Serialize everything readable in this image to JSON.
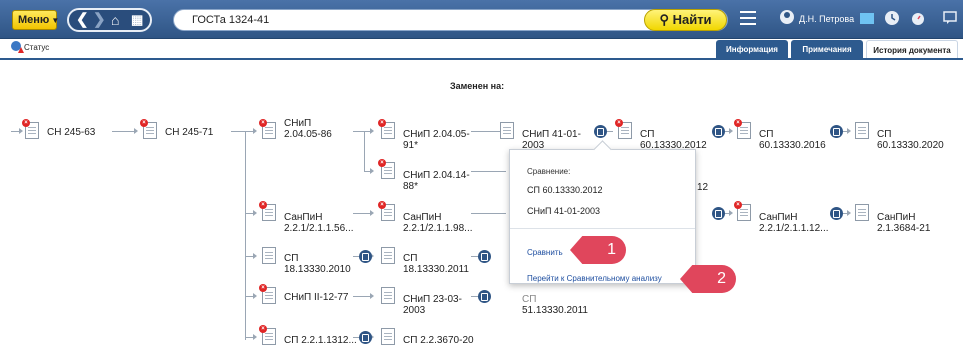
{
  "topbar": {
    "menu_label": "Меню",
    "search_value": "ГОСТа 1324-41",
    "find_label": "Найти",
    "user_name": "Д.Н. Петрова"
  },
  "tabs": {
    "status_label": "Статус",
    "items": [
      "Информация",
      "Примечания",
      "История документа"
    ],
    "active": "История документа"
  },
  "history": {
    "heading": "Заменен на:",
    "nodes": [
      {
        "lines": [
          "СН 245-63"
        ]
      },
      {
        "lines": [
          "СН 245-71"
        ]
      },
      {
        "lines": [
          "СНиП",
          "2.04.05-86"
        ]
      },
      {
        "lines": [
          "СНиП 2.04.05-",
          "91*"
        ]
      },
      {
        "lines": [
          "СНиП 41-01-",
          "2003"
        ]
      },
      {
        "lines": [
          "СП",
          "60.13330.2012"
        ]
      },
      {
        "lines": [
          "СП",
          "60.13330.2016"
        ]
      },
      {
        "lines": [
          "СП",
          "60.13330.2020"
        ]
      },
      {
        "lines": [
          "СНиП 2.04.14-",
          "88*"
        ]
      },
      {
        "lines": [
          "12"
        ]
      },
      {
        "lines": [
          "СанПиН",
          "2.2.1/2.1.1.56..."
        ]
      },
      {
        "lines": [
          "СанПиН",
          "2.2.1/2.1.1.98..."
        ]
      },
      {
        "lines": [
          "СанПиН",
          "2.2.1/2.1.1.12..."
        ]
      },
      {
        "lines": [
          "СанПиН",
          "2.1.3684-21"
        ]
      },
      {
        "lines": [
          "СП",
          "18.13330.2010"
        ]
      },
      {
        "lines": [
          "СП",
          "18.13330.2011"
        ]
      },
      {
        "lines": [
          "СНиП II-12-77"
        ]
      },
      {
        "lines": [
          "СНиП 23-03-",
          "2003"
        ]
      },
      {
        "lines": [
          "СП",
          "51.13330.2011"
        ]
      },
      {
        "lines": [
          "СП 2.2.1.1312..."
        ]
      },
      {
        "lines": [
          "СП 2.2.3670-20"
        ]
      }
    ]
  },
  "popup": {
    "title": "Сравнение:",
    "doc1": "СП 60.13330.2012",
    "doc2": "СНиП 41-01-2003",
    "compare_link": "Сравнить",
    "analysis_link": "Перейти к Сравнительному анализу",
    "callout1": "1",
    "callout2": "2"
  },
  "colors": {
    "topbar": "#2f5585",
    "menu_button": "#f2c400",
    "callout": "#e0465c",
    "link": "#1f4fa0",
    "not_active_mark": "#e02626"
  }
}
